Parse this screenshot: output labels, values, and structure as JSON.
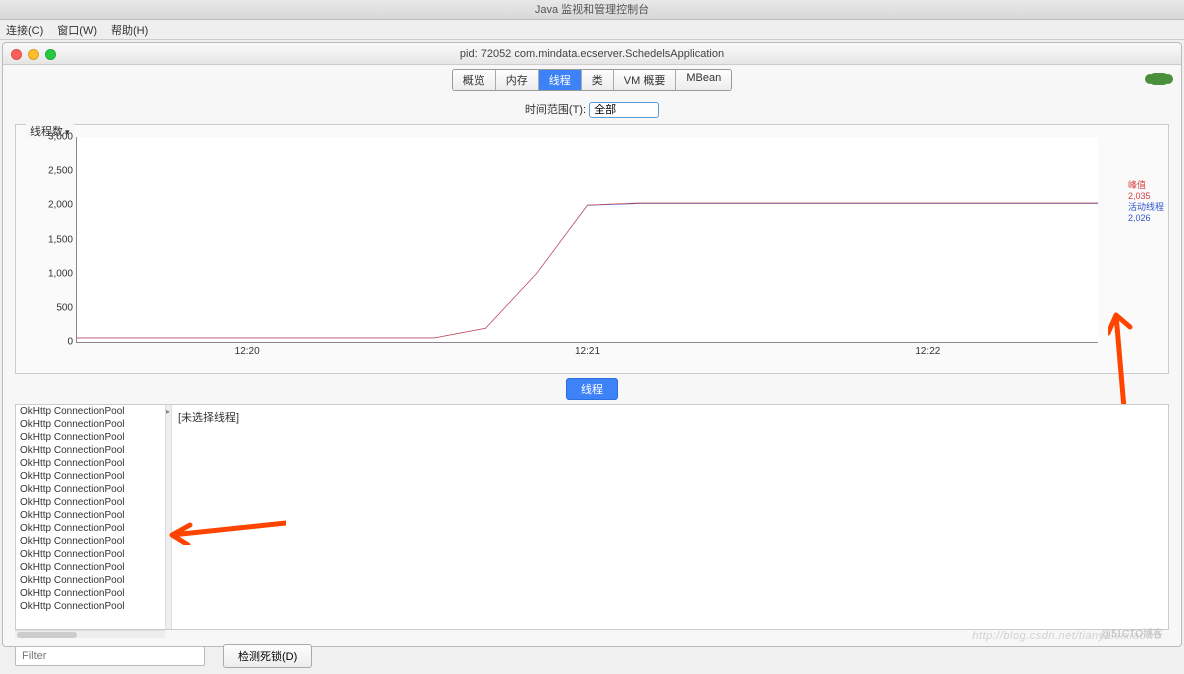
{
  "app_title": "Java 监视和管理控制台",
  "menus": {
    "connect": "连接(C)",
    "window": "窗口(W)",
    "help": "帮助(H)"
  },
  "window_title": "pid: 72052 com.mindata.ecserver.SchedelsApplication",
  "tabs": {
    "overview": "概览",
    "memory": "内存",
    "threads": "线程",
    "classes": "类",
    "vm": "VM 概要",
    "mbean": "MBean"
  },
  "time_range": {
    "label": "时间范围(T):",
    "value": "全部"
  },
  "chart_data": {
    "type": "line",
    "title": "线程数",
    "ylabel": "",
    "ylim": [
      0,
      3000
    ],
    "yticks": [
      0,
      500,
      1000,
      1500,
      2000,
      2500,
      3000
    ],
    "xticks": [
      "12:20",
      "12:21",
      "12:22"
    ],
    "series": [
      {
        "name": "活动线程",
        "color": "#4151b5",
        "points": [
          [
            0.0,
            60
          ],
          [
            0.35,
            60
          ],
          [
            0.4,
            200
          ],
          [
            0.45,
            1000
          ],
          [
            0.5,
            2000
          ],
          [
            0.55,
            2026
          ],
          [
            1.0,
            2026
          ]
        ]
      },
      {
        "name": "峰值",
        "color": "#d94040",
        "points": [
          [
            0.0,
            60
          ],
          [
            0.35,
            60
          ],
          [
            0.4,
            200
          ],
          [
            0.45,
            1000
          ],
          [
            0.5,
            2005
          ],
          [
            0.55,
            2035
          ],
          [
            1.0,
            2035
          ]
        ]
      }
    ],
    "legend": {
      "peak_label": "峰值",
      "peak_value": "2,035",
      "live_label": "活动线程",
      "live_value": "2,026"
    }
  },
  "threads_button": "线程",
  "thread_list": [
    "OkHttp ConnectionPool",
    "OkHttp ConnectionPool",
    "OkHttp ConnectionPool",
    "OkHttp ConnectionPool",
    "OkHttp ConnectionPool",
    "OkHttp ConnectionPool",
    "OkHttp ConnectionPool",
    "OkHttp ConnectionPool",
    "OkHttp ConnectionPool",
    "OkHttp ConnectionPool",
    "OkHttp ConnectionPool",
    "OkHttp ConnectionPool",
    "OkHttp ConnectionPool",
    "OkHttp ConnectionPool",
    "OkHttp ConnectionPool",
    "OkHttp ConnectionPool"
  ],
  "detail_placeholder": "[未选择线程]",
  "filter_placeholder": "Filter",
  "deadlock_button": "检测死锁(D)",
  "watermark": "http://blog.csdn.net/tianyaleixiaowu",
  "watermark2": "@51CTO博客"
}
